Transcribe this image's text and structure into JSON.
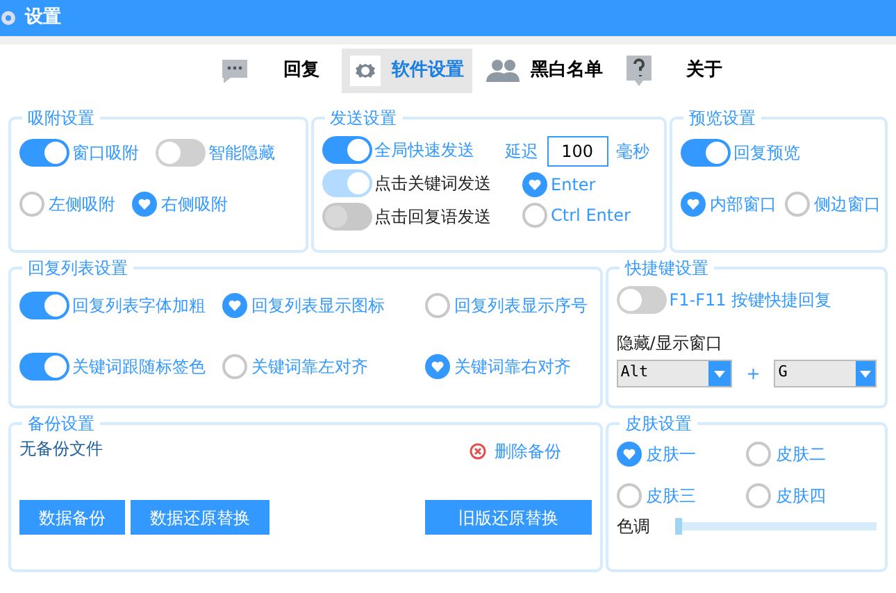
{
  "window": {
    "title": "设置"
  },
  "tabs": [
    {
      "label": "回复",
      "selected": false
    },
    {
      "label": "软件设置",
      "selected": true
    },
    {
      "label": "黑白名单",
      "selected": false
    },
    {
      "label": "关于",
      "selected": false
    }
  ],
  "attach": {
    "title": "吸附设置",
    "rows": [
      [
        {
          "kind": "toggle",
          "label": "窗口吸附",
          "on": true
        },
        {
          "kind": "toggle",
          "label": "智能隐藏",
          "on": false
        }
      ],
      [
        {
          "kind": "radio",
          "label": "左侧吸附",
          "selected": false
        },
        {
          "kind": "radio",
          "label": "右侧吸附",
          "selected": true
        }
      ]
    ]
  },
  "send": {
    "title": "发送设置",
    "toggles": [
      {
        "label": "全局快速发送",
        "on": true,
        "disabled": false
      },
      {
        "label": "点击关键词发送",
        "on": true,
        "disabled": true
      },
      {
        "label": "点击回复语发送",
        "on": false,
        "disabled": true
      }
    ],
    "delay_label": "延迟",
    "delay_value": "100",
    "delay_unit": "毫秒",
    "keys": [
      {
        "label": "Enter",
        "selected": true
      },
      {
        "label": "Ctrl Enter",
        "selected": false
      }
    ]
  },
  "preview": {
    "title": "预览设置",
    "rows": [
      [
        {
          "kind": "toggle",
          "label": "回复预览",
          "on": true
        }
      ],
      [
        {
          "kind": "radio",
          "label": "内部窗口",
          "selected": true
        },
        {
          "kind": "radio",
          "label": "侧边窗口",
          "selected": false
        }
      ]
    ]
  },
  "reply_list": {
    "title": "回复列表设置",
    "rows": [
      [
        {
          "kind": "toggle",
          "label": "回复列表字体加粗",
          "on": true
        },
        {
          "kind": "radio",
          "label": "回复列表显示图标",
          "selected": true
        },
        {
          "kind": "radio",
          "label": "回复列表显示序号",
          "selected": false
        }
      ],
      [
        {
          "kind": "toggle",
          "label": "关键词跟随标签色",
          "on": true
        },
        {
          "kind": "radio",
          "label": "关键词靠左对齐",
          "selected": false
        },
        {
          "kind": "radio",
          "label": "关键词靠右对齐",
          "selected": true
        }
      ]
    ]
  },
  "hotkey": {
    "title": "快捷键设置",
    "toggle": {
      "label": "F1-F11 按键快捷回复",
      "on": false
    },
    "label": "隐藏/显示窗口",
    "modifier": "Alt",
    "plus": "+",
    "key": "G"
  },
  "backup": {
    "title": "备份设置",
    "status": "无备份文件",
    "delete": "删除备份",
    "buttons": [
      "数据备份",
      "数据还原替换"
    ],
    "old_button": "旧版还原替换"
  },
  "skin": {
    "title": "皮肤设置",
    "options": [
      {
        "label": "皮肤一",
        "selected": true
      },
      {
        "label": "皮肤二",
        "selected": false
      },
      {
        "label": "皮肤三",
        "selected": false
      },
      {
        "label": "皮肤四",
        "selected": false
      }
    ],
    "hue_label": "色调",
    "hue": {
      "level": 0.0
    }
  }
}
